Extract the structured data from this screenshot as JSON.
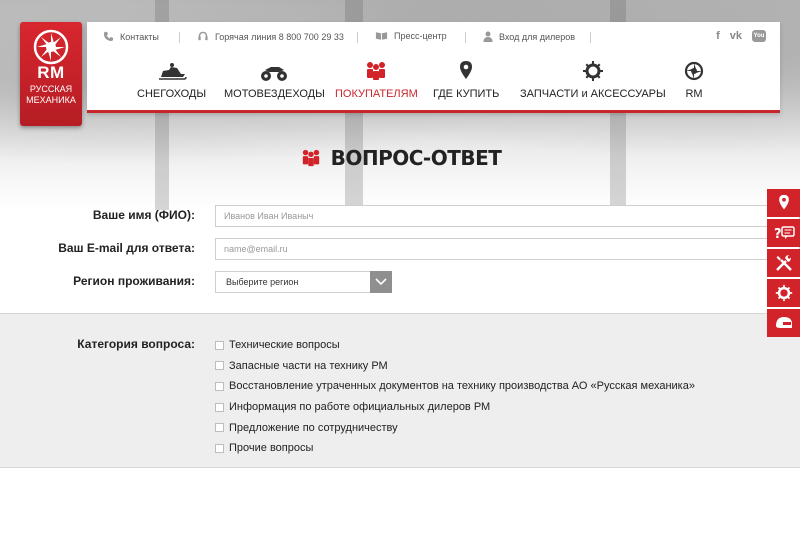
{
  "logo": {
    "abbr": "RM",
    "line1": "РУССКАЯ",
    "line2": "МЕХАНИКА"
  },
  "topbar": {
    "contacts": "Контакты",
    "hotline": "Горячая линия 8 800 700 29 33",
    "press": "Пресс-центр",
    "dealers": "Вход для дилеров",
    "social": [
      "f",
      "vk",
      "You"
    ]
  },
  "nav": [
    {
      "label": "СНЕГОХОДЫ",
      "icon": "snowmobile-icon"
    },
    {
      "label": "МОТОВЕЗДЕХОДЫ",
      "icon": "atv-icon"
    },
    {
      "label": "ПОКУПАТЕЛЯМ",
      "icon": "customers-icon",
      "active": true
    },
    {
      "label": "ГДЕ КУПИТЬ",
      "icon": "location-pin-icon"
    },
    {
      "label": "ЗАПЧАСТИ и АКСЕССУАРЫ",
      "icon": "gear-icon"
    },
    {
      "label": "RM",
      "icon": "rm-wheel-icon"
    }
  ],
  "page": {
    "title": "ВОПРОС-ОТВЕТ"
  },
  "form": {
    "name_label": "Ваше имя (ФИО):",
    "name_placeholder": "Иванов Иван Иваныч",
    "email_label": "Ваш E-mail для ответа:",
    "email_placeholder": "name@email.ru",
    "region_label": "Регион проживания:",
    "region_value": "Выберите регион",
    "category_label": "Категория вопроса:",
    "categories": [
      "Технические вопросы",
      "Запасные части на технику РМ",
      "Восстановление утраченных документов на технику производства АО «Русская механика»",
      "Информация по работе официальных дилеров РМ",
      "Предложение по сотрудничеству",
      "Прочие вопросы"
    ]
  },
  "colors": {
    "accent": "#d2232a",
    "background_gray": "#eeeeee"
  },
  "side_tabs": [
    "location-pin-icon",
    "question-chat-icon",
    "tools-icon",
    "gear-icon",
    "helmet-icon"
  ]
}
